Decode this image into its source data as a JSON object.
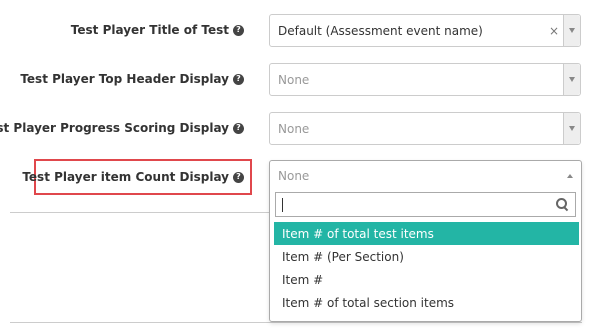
{
  "fields": [
    {
      "label": "Test Player Title of Test",
      "value": "Default (Assessment event name)",
      "placeholder": false,
      "clear": "×"
    },
    {
      "label": "Test Player Top Header Display",
      "value": "None",
      "placeholder": true
    },
    {
      "label": "Test Player Progress Scoring Display",
      "value": "None",
      "placeholder": true
    },
    {
      "label": "Test Player item Count Display",
      "value": "None",
      "placeholder": true
    }
  ],
  "help_glyph": "?",
  "dropdown": {
    "search_value": "",
    "options": [
      {
        "label": "Item # of total test items",
        "active": true
      },
      {
        "label": "Item # (Per Section)",
        "active": false
      },
      {
        "label": "Item #",
        "active": false
      },
      {
        "label": "Item # of total section items",
        "active": false
      }
    ]
  },
  "colors": {
    "highlight_border": "#e0474c",
    "active_option_bg": "#23b5a5"
  },
  "icons": [
    "help-icon",
    "clear-icon",
    "chevron-down-icon",
    "chevron-up-icon",
    "search-icon"
  ]
}
